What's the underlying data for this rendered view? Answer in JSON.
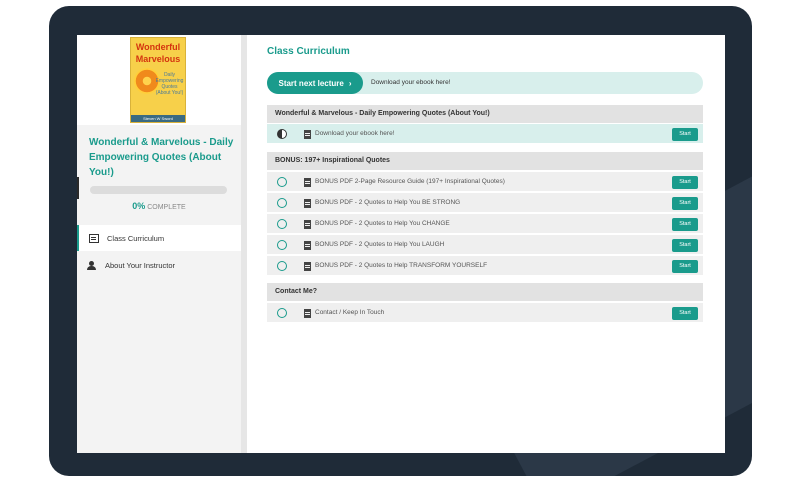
{
  "sidebar": {
    "cover": {
      "title_line1": "Wonderful",
      "title_line2": "Marvelous",
      "subtitle": "Daily Empowering Quotes (About You!)",
      "author": "Steven W Sword"
    },
    "course_title": "Wonderful & Marvelous - Daily Empowering Quotes (About You!)",
    "progress": {
      "percent": 0,
      "label": "0%",
      "suffix": "COMPLETE"
    },
    "nav": [
      {
        "label": "Class Curriculum",
        "icon": "list-icon",
        "active": true
      },
      {
        "label": "About Your Instructor",
        "icon": "person-icon",
        "active": false
      }
    ]
  },
  "main": {
    "title": "Class Curriculum",
    "next_button": "Start next lecture",
    "next_text": "Download your ebook here!",
    "sections": [
      {
        "title": "Wonderful & Marvelous - Daily Empowering Quotes (About You!)",
        "lectures": [
          {
            "title": "Download your ebook here!",
            "button": "Start",
            "status": "in-progress"
          }
        ]
      },
      {
        "title": "BONUS: 197+ Inspirational Quotes",
        "lectures": [
          {
            "title": "BONUS PDF 2-Page Resource Guide (197+ Inspirational Quotes)",
            "button": "Start",
            "status": "not-started"
          },
          {
            "title": "BONUS PDF - 2 Quotes to Help You BE STRONG",
            "button": "Start",
            "status": "not-started"
          },
          {
            "title": "BONUS PDF - 2 Quotes to Help You CHANGE",
            "button": "Start",
            "status": "not-started"
          },
          {
            "title": "BONUS PDF - 2 Quotes to Help You LAUGH",
            "button": "Start",
            "status": "not-started"
          },
          {
            "title": "BONUS PDF - 2 Quotes to Help TRANSFORM YOURSELF",
            "button": "Start",
            "status": "not-started"
          }
        ]
      },
      {
        "title": "Contact Me?",
        "lectures": [
          {
            "title": "Contact / Keep In Touch",
            "button": "Start",
            "status": "not-started"
          }
        ]
      }
    ]
  },
  "colors": {
    "accent": "#1a9b8c",
    "bezel": "#1f2b38",
    "highlight": "#d8efec"
  }
}
